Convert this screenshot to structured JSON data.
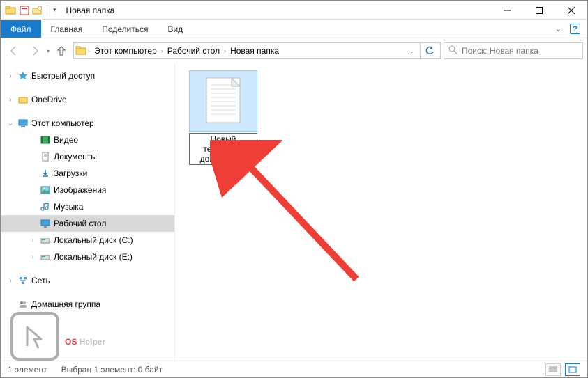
{
  "titlebar": {
    "title": "Новая папка"
  },
  "ribbon": {
    "tabs": {
      "file": "Файл",
      "home": "Главная",
      "share": "Поделиться",
      "view": "Вид"
    }
  },
  "breadcrumb": {
    "items": [
      "Этот компьютер",
      "Рабочий стол",
      "Новая папка"
    ]
  },
  "search": {
    "placeholder": "Поиск: Новая папка"
  },
  "sidebar": {
    "quick_access": "Быстрый доступ",
    "onedrive": "OneDrive",
    "this_pc": "Этот компьютер",
    "children": {
      "videos": "Видео",
      "documents": "Документы",
      "downloads": "Загрузки",
      "pictures": "Изображения",
      "music": "Музыка",
      "desktop": "Рабочий стол",
      "disk_c": "Локальный диск (C:)",
      "disk_e": "Локальный диск (E:)"
    },
    "network": "Сеть",
    "homegroup": "Домашняя группа"
  },
  "file": {
    "name_prefix": "Новый текстовый документ.",
    "name_selected": "txt"
  },
  "statusbar": {
    "count": "1 элемент",
    "selection": "Выбран 1 элемент: 0 байт"
  },
  "watermark": {
    "part1": "OS",
    "part2": " Helper"
  }
}
